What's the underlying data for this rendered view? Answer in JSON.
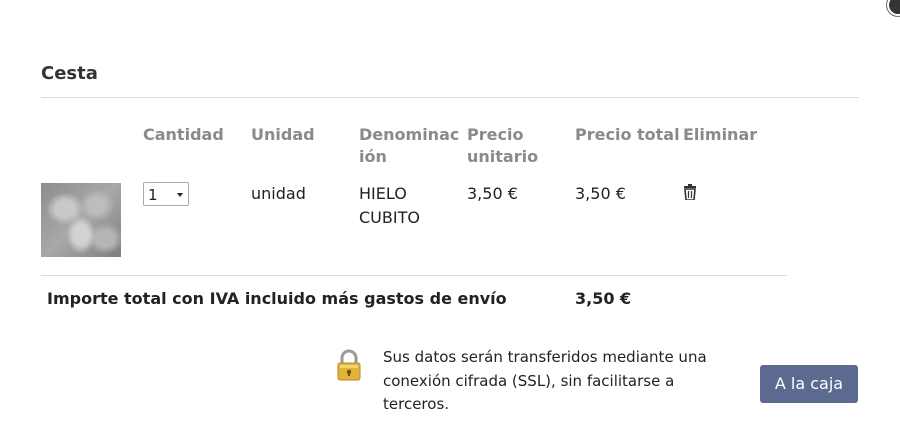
{
  "cart": {
    "title": "Cesta",
    "headers": {
      "quantity": "Cantidad",
      "unit": "Unidad",
      "name": "Denominación",
      "unit_price": "Precio unitario",
      "total_price": "Precio total",
      "delete": "Eliminar"
    },
    "items": [
      {
        "quantity": "1",
        "unit": "unidad",
        "name": "HIELO CUBITO",
        "unit_price": "3,50 €",
        "total_price": "3,50 €",
        "delete_icon": "trash-icon"
      }
    ],
    "total": {
      "label": "Importe total con IVA incluido más gastos de envío",
      "value": "3,50 €"
    },
    "ssl_note": "Sus datos serán transferidos mediante una conexión cifrada (SSL), sin facilitarse a terceros.",
    "checkout_label": "A la caja",
    "colors": {
      "checkout_button": "#5b6a8e",
      "header_text": "#8a8a8a",
      "lock": "#e0b43a"
    }
  }
}
